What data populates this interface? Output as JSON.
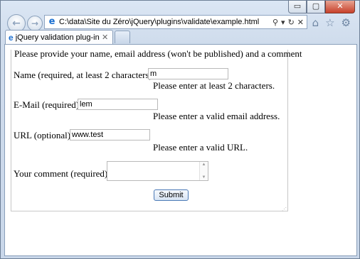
{
  "window": {
    "caption": {
      "minimize": "▭",
      "maximize": "▢",
      "close": "✕"
    }
  },
  "nav": {
    "back_glyph": "←",
    "forward_glyph": "→"
  },
  "address_bar": {
    "url": "C:\\data\\Site du Zéro\\jQuery\\plugins\\validate\\example.html",
    "search_glyph": "⚲",
    "dropdown_glyph": "▾",
    "refresh_glyph": "↻",
    "stop_glyph": "✕"
  },
  "toolbar": {
    "home_glyph": "⌂",
    "favorites_glyph": "☆",
    "tools_glyph": "⚙"
  },
  "tab": {
    "title": "jQuery validation plug-in - ...",
    "close_glyph": "✕",
    "favicon": "e"
  },
  "form": {
    "legend": "Please provide your name, email address (won't be published) and a comment",
    "name": {
      "label": "Name (required, at least 2 characters)",
      "value": "m",
      "error": "Please enter at least 2 characters."
    },
    "email": {
      "label": "E-Mail (required)",
      "value": "lem",
      "error": "Please enter a valid email address."
    },
    "url": {
      "label": "URL (optional)",
      "value": "www.test",
      "error": "Please enter a valid URL."
    },
    "comment": {
      "label": "Your comment (required)",
      "value": ""
    },
    "submit_label": "Submit"
  },
  "colors": {
    "frame": "#c9d7ea",
    "accent": "#1a6fd1",
    "close_button": "#c7402a"
  }
}
